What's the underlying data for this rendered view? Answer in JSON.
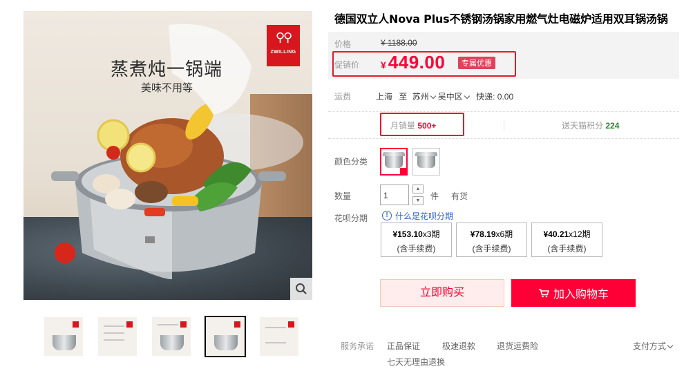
{
  "product": {
    "title": "德国双立人Nova Plus不锈钢汤锅家用燃气灶电磁炉适用双耳锅汤锅",
    "image": {
      "headline": "蒸煮炖一锅端",
      "subline": "美味不用等",
      "brand": "ZWILLING"
    },
    "thumbnails_count": 5,
    "active_thumbnail": 4
  },
  "price": {
    "orig_label": "价格",
    "orig_value": "¥ 1188.00",
    "promo_label": "促销价",
    "currency": "¥",
    "promo_value": "449.00",
    "promo_tag": "专属优惠"
  },
  "shipping": {
    "label": "运费",
    "from": "上海",
    "to_word": "至",
    "city": "苏州",
    "district": "吴中区",
    "express": "快递: 0.00"
  },
  "stats": {
    "sales_label": "月销量",
    "sales_value": "500+",
    "points_label": "送天猫积分",
    "points_value": "224"
  },
  "options": {
    "color_label": "颜色分类",
    "qty_label": "数量",
    "qty_value": "1",
    "qty_unit": "件",
    "stock": "有货",
    "installment_label": "花呗分期",
    "huabei_link": "什么是花呗分期",
    "installments": [
      {
        "amount": "¥153.10",
        "periods": "x3期",
        "fee": "(含手续费)"
      },
      {
        "amount": "¥78.19",
        "periods": "x6期",
        "fee": "(含手续费)"
      },
      {
        "amount": "¥40.21",
        "periods": "x12期",
        "fee": "(含手续费)"
      }
    ]
  },
  "actions": {
    "buy_now": "立即购买",
    "add_cart": "加入购物车"
  },
  "services": {
    "label": "服务承诺",
    "items": [
      "正品保证",
      "极速退款",
      "退货运费险",
      "七天无理由退换"
    ],
    "pay_methods": "支付方式"
  },
  "colors": {
    "accent": "#ff0036",
    "highlight_box": "#e21a2c",
    "link": "#3366cc",
    "points": "#228b22"
  }
}
